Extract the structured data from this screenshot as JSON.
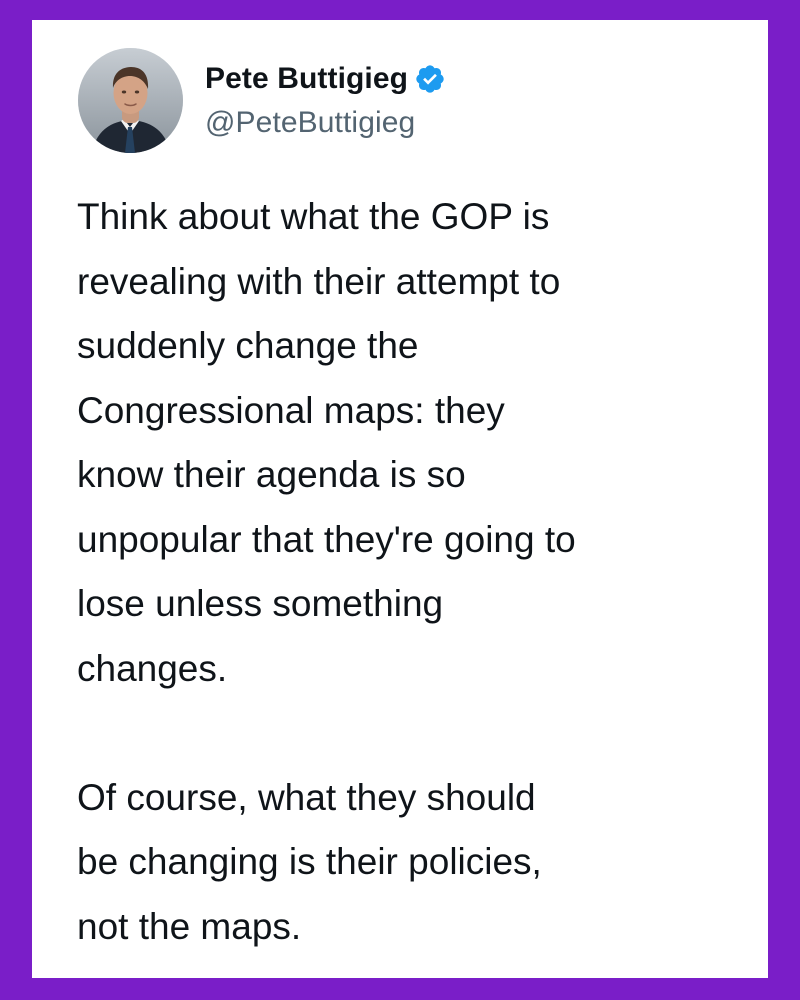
{
  "tweet": {
    "author": {
      "display_name": "Pete Buttigieg",
      "handle": "@PeteButtigieg",
      "verified": true,
      "avatar_icon": "profile-photo",
      "verified_icon": "verified-badge-icon"
    },
    "body": {
      "paragraphs": [
        {
          "lines": [
            "Think about what the GOP is",
            "revealing with their attempt to",
            "suddenly change the",
            "Congressional maps: they",
            "know their agenda is so",
            "unpopular that they're going to",
            "lose unless something",
            "changes."
          ]
        },
        {
          "lines": [
            "Of course, what they should",
            "be changing is their policies,",
            "not the maps."
          ]
        }
      ]
    }
  },
  "colors": {
    "frame_background": "#7a1ec8",
    "card_background": "#ffffff",
    "text_primary": "#0f1419",
    "text_secondary": "#536471",
    "verified_blue": "#1d9bf0"
  }
}
